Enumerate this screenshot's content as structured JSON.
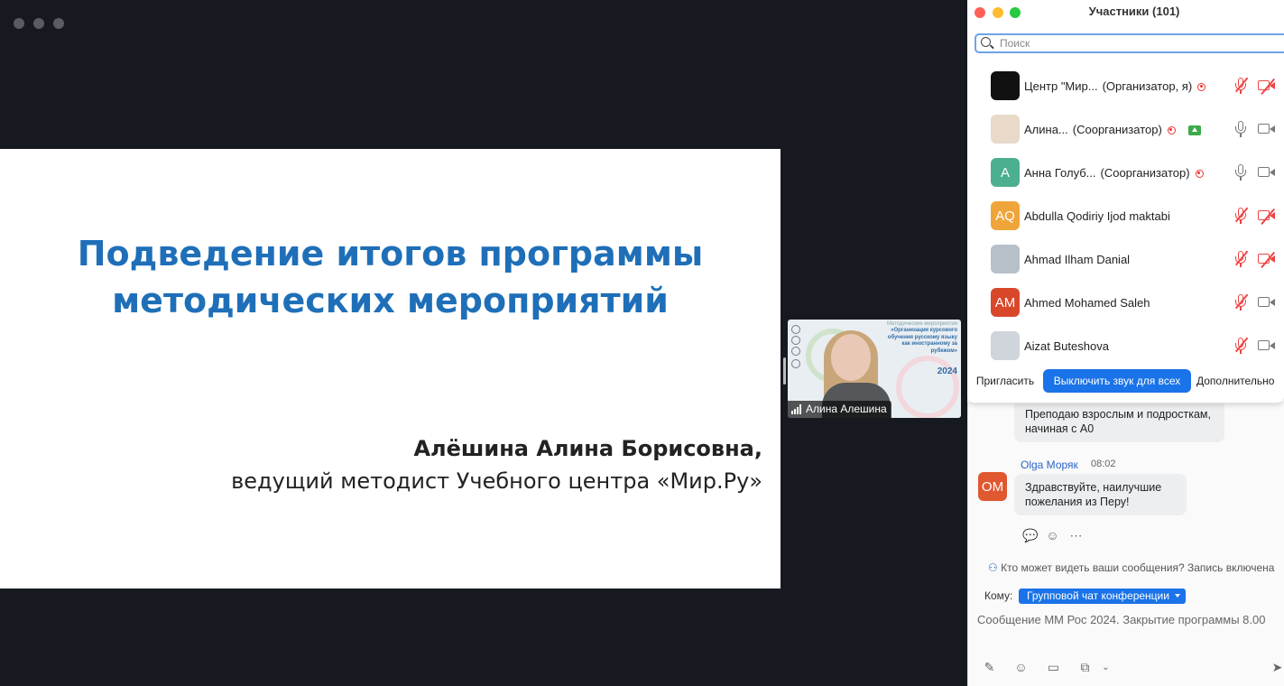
{
  "slide": {
    "title_line1": "Подведение итогов программы",
    "title_line2": "методических мероприятий",
    "author_name": "Алёшина Алина Борисовна,",
    "author_role": "ведущий методист Учебного центра «Мир.Ру»"
  },
  "speaker": {
    "name": "Алина Алешина",
    "background_text_1": "Методические мероприятия",
    "background_text_2": "«Организация курсового обучения русскому языку как иностранному за рубежом»",
    "background_year": "2024"
  },
  "participants": {
    "title": "Участники (101)",
    "search_placeholder": "Поиск",
    "list": [
      {
        "avatar_initials": "",
        "name": "Центр \"Мир...",
        "role": "(Организатор, я)",
        "avatar_color": "#111111",
        "recording": true,
        "sharing": false,
        "mic_muted": true,
        "video_off": true
      },
      {
        "avatar_initials": "",
        "name": "Алина...",
        "role": "(Соорганизатор)",
        "avatar_color": "#e8d9c8",
        "recording": true,
        "sharing": true,
        "mic_muted": false,
        "video_off": false
      },
      {
        "avatar_initials": "A",
        "name": "Анна Голуб...",
        "role": "(Соорганизатор)",
        "avatar_color": "#4caf8f",
        "recording": true,
        "sharing": false,
        "mic_muted": false,
        "video_off": false
      },
      {
        "avatar_initials": "AQ",
        "name": "Abdulla Qodiriy Ijod maktabi",
        "role": "",
        "avatar_color": "#f0a53a",
        "recording": false,
        "sharing": false,
        "mic_muted": true,
        "video_off": true
      },
      {
        "avatar_initials": "",
        "name": "Ahmad Ilham Danial",
        "role": "",
        "avatar_color": "#b7c0c8",
        "recording": false,
        "sharing": false,
        "mic_muted": true,
        "video_off": true
      },
      {
        "avatar_initials": "AM",
        "name": "Ahmed Mohamed Saleh",
        "role": "",
        "avatar_color": "#d9472b",
        "recording": false,
        "sharing": false,
        "mic_muted": true,
        "video_off": false
      },
      {
        "avatar_initials": "",
        "name": "Aizat Buteshova",
        "role": "",
        "avatar_color": "#cfd5da",
        "recording": false,
        "sharing": false,
        "mic_muted": true,
        "video_off": false
      }
    ],
    "invite_label": "Пригласить",
    "mute_all_label": "Выключить звук для всех",
    "more_label": "Дополнительно"
  },
  "chat": {
    "prev_message_text": "Преподаю взрослым и подросткам, начиная с А0",
    "message": {
      "avatar_initials": "OM",
      "avatar_color": "#e0582f",
      "sender": "Olga Моряк",
      "time": "08:02",
      "text": "Здравствуйте, наилучшие пожелания из Перу!"
    },
    "visibility_notice": "Кто может видеть ваши сообщения? Запись включена",
    "to_label": "Кому:",
    "to_value": "Групповой чат конференции",
    "draft_text": "Сообщение ММ Рос 2024. Закрытие программы 8.00"
  },
  "colors": {
    "accent": "#1a73e8",
    "slide_title": "#1f6fb8",
    "stage_bg": "#171920",
    "muted_red": "#e44444"
  }
}
